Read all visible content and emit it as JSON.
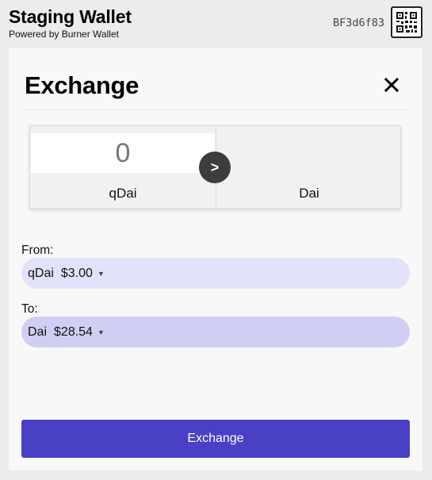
{
  "header": {
    "title": "Staging Wallet",
    "subtitle": "Powered by Burner Wallet",
    "address": "BF3d6f83",
    "qr_icon": "qr-code-icon"
  },
  "exchange": {
    "title": "Exchange",
    "close_icon": "close-icon",
    "amount_value": "0",
    "from_token": "qDai",
    "to_token": "Dai",
    "arrow_glyph": ">",
    "from_label": "From:",
    "from_select": {
      "token": "qDai",
      "balance": "$3.00"
    },
    "to_label": "To:",
    "to_select": {
      "token": "Dai",
      "balance": "$28.54"
    },
    "submit_label": "Exchange"
  },
  "colors": {
    "accent": "#4a40c5",
    "from_pill": "#e3e2fb",
    "to_pill": "#d0cff3",
    "arrow_bg": "#3d3d3d"
  }
}
